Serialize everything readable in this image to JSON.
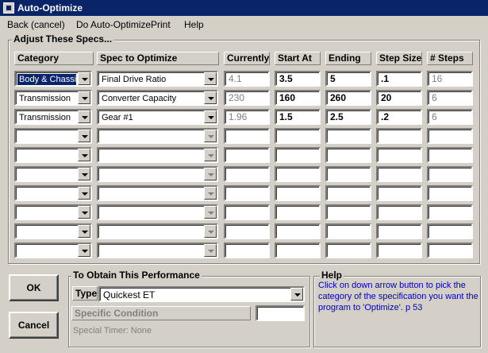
{
  "window": {
    "title": "Auto-Optimize"
  },
  "menu": [
    {
      "label": "Back (cancel)"
    },
    {
      "label": "Do Auto-Optimize"
    },
    {
      "label": "Print"
    },
    {
      "label": "Help"
    }
  ],
  "specs": {
    "title": "Adjust These Specs...",
    "headers": {
      "category": "Category",
      "spec": "Spec to Optimize",
      "currently": "Currently",
      "start": "Start At",
      "ending": "Ending",
      "step": "Step Size",
      "steps": "# Steps"
    },
    "rows": [
      {
        "category": "Body & Chassis",
        "spec": "Final Drive Ratio",
        "currently": "4.1",
        "start": "3.5",
        "ending": "5",
        "step": ".1",
        "steps": "16"
      },
      {
        "category": "Transmission",
        "spec": "Converter Capacity",
        "currently": "230",
        "start": "160",
        "ending": "260",
        "step": "20",
        "steps": "6"
      },
      {
        "category": "Transmission",
        "spec": "Gear #1",
        "currently": "1.96",
        "start": "1.5",
        "ending": "2.5",
        "step": ".2",
        "steps": "6"
      },
      {
        "category": "",
        "spec": "",
        "currently": "",
        "start": "",
        "ending": "",
        "step": "",
        "steps": ""
      },
      {
        "category": "",
        "spec": "",
        "currently": "",
        "start": "",
        "ending": "",
        "step": "",
        "steps": ""
      },
      {
        "category": "",
        "spec": "",
        "currently": "",
        "start": "",
        "ending": "",
        "step": "",
        "steps": ""
      },
      {
        "category": "",
        "spec": "",
        "currently": "",
        "start": "",
        "ending": "",
        "step": "",
        "steps": ""
      },
      {
        "category": "",
        "spec": "",
        "currently": "",
        "start": "",
        "ending": "",
        "step": "",
        "steps": ""
      },
      {
        "category": "",
        "spec": "",
        "currently": "",
        "start": "",
        "ending": "",
        "step": "",
        "steps": ""
      },
      {
        "category": "",
        "spec": "",
        "currently": "",
        "start": "",
        "ending": "",
        "step": "",
        "steps": ""
      }
    ]
  },
  "buttons": {
    "ok": "OK",
    "cancel": "Cancel"
  },
  "performance": {
    "title": "To Obtain This Performance",
    "type_label": "Type",
    "type_value": "Quickest ET",
    "specific_condition": "Specific Condition",
    "special_timer": "Special Timer: None"
  },
  "help": {
    "title": "Help",
    "text": "Click on down arrow button to pick the category of the specification you want the program to 'Optimize'.  p 53"
  }
}
